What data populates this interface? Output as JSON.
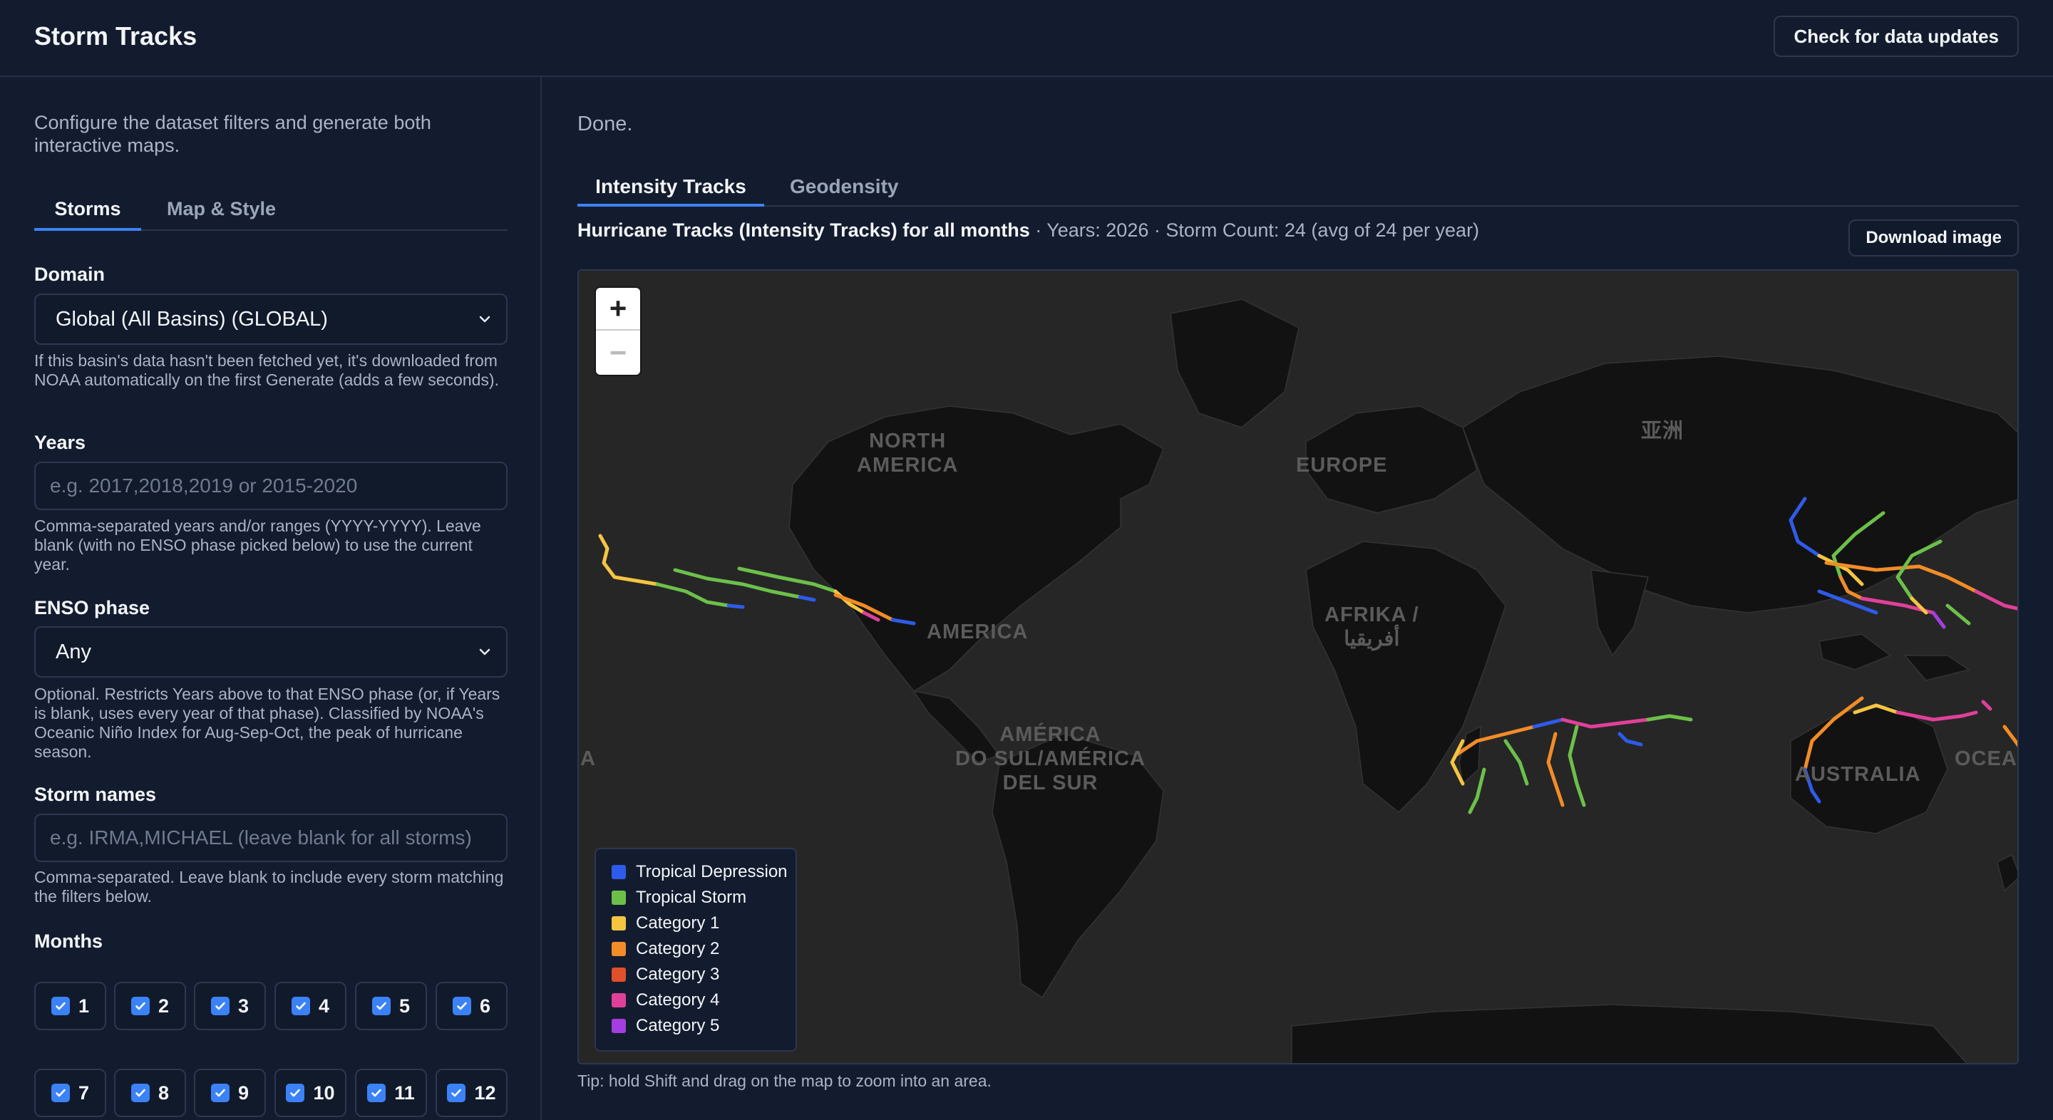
{
  "app": {
    "title": "Storm Tracks",
    "update_button": "Check for data updates"
  },
  "sidebar": {
    "intro": "Configure the dataset filters and generate both interactive maps.",
    "tabs": [
      {
        "label": "Storms",
        "active": true
      },
      {
        "label": "Map & Style",
        "active": false
      }
    ],
    "domain": {
      "label": "Domain",
      "value": "Global (All Basins) (GLOBAL)",
      "help": "If this basin's data hasn't been fetched yet, it's downloaded from NOAA automatically on the first Generate (adds a few seconds)."
    },
    "years": {
      "label": "Years",
      "value": "",
      "placeholder": "e.g. 2017,2018,2019 or 2015-2020",
      "help": "Comma-separated years and/or ranges (YYYY-YYYY). Leave blank (with no ENSO phase picked below) to use the current year."
    },
    "enso": {
      "label": "ENSO phase",
      "value": "Any",
      "help": "Optional. Restricts Years above to that ENSO phase (or, if Years is blank, uses every year of that phase). Classified by NOAA's Oceanic Niño Index for Aug-Sep-Oct, the peak of hurricane season."
    },
    "storm_names": {
      "label": "Storm names",
      "value": "",
      "placeholder": "e.g. IRMA,MICHAEL (leave blank for all storms)",
      "help": "Comma-separated. Leave blank to include every storm matching the filters below."
    },
    "months": {
      "label": "Months",
      "items": [
        {
          "label": "1",
          "checked": true
        },
        {
          "label": "2",
          "checked": true
        },
        {
          "label": "3",
          "checked": true
        },
        {
          "label": "4",
          "checked": true
        },
        {
          "label": "5",
          "checked": true
        },
        {
          "label": "6",
          "checked": true
        },
        {
          "label": "7",
          "checked": true
        },
        {
          "label": "8",
          "checked": true
        },
        {
          "label": "9",
          "checked": true
        },
        {
          "label": "10",
          "checked": true
        },
        {
          "label": "11",
          "checked": true
        },
        {
          "label": "12",
          "checked": true
        }
      ]
    }
  },
  "main": {
    "status": "Done.",
    "tabs": [
      {
        "label": "Intensity Tracks",
        "active": true
      },
      {
        "label": "Geodensity",
        "active": false
      }
    ],
    "map_title": "Hurricane Tracks (Intensity Tracks) for all months",
    "map_meta": " · Years: 2026 · Storm Count: 24 (avg of 24 per year)",
    "download_button": "Download image",
    "tip": "Tip: hold Shift and drag on the map to zoom into an area.",
    "zoom": {
      "in": "+",
      "out": "−"
    },
    "map_labels": {
      "north_america": "NORTH\nAMERICA",
      "europe": "EUROPE",
      "asia": "亚洲",
      "america": "AMERICA",
      "africa": "AFRIKA /\nأفريقيا",
      "south_america": "AMÉRICA\nDO SUL/AMÉRICA\nDEL SUR",
      "australia": "AUSTRALIA",
      "oceania": "OCEA",
      "edge_a": "A"
    },
    "legend": [
      {
        "label": "Tropical Depression",
        "color": "#2f5bea"
      },
      {
        "label": "Tropical Storm",
        "color": "#6cc04a"
      },
      {
        "label": "Category 1",
        "color": "#f5c542"
      },
      {
        "label": "Category 2",
        "color": "#f28c28"
      },
      {
        "label": "Category 3",
        "color": "#e0502a"
      },
      {
        "label": "Category 4",
        "color": "#e0409a"
      },
      {
        "label": "Category 5",
        "color": "#a43ee0"
      }
    ]
  }
}
